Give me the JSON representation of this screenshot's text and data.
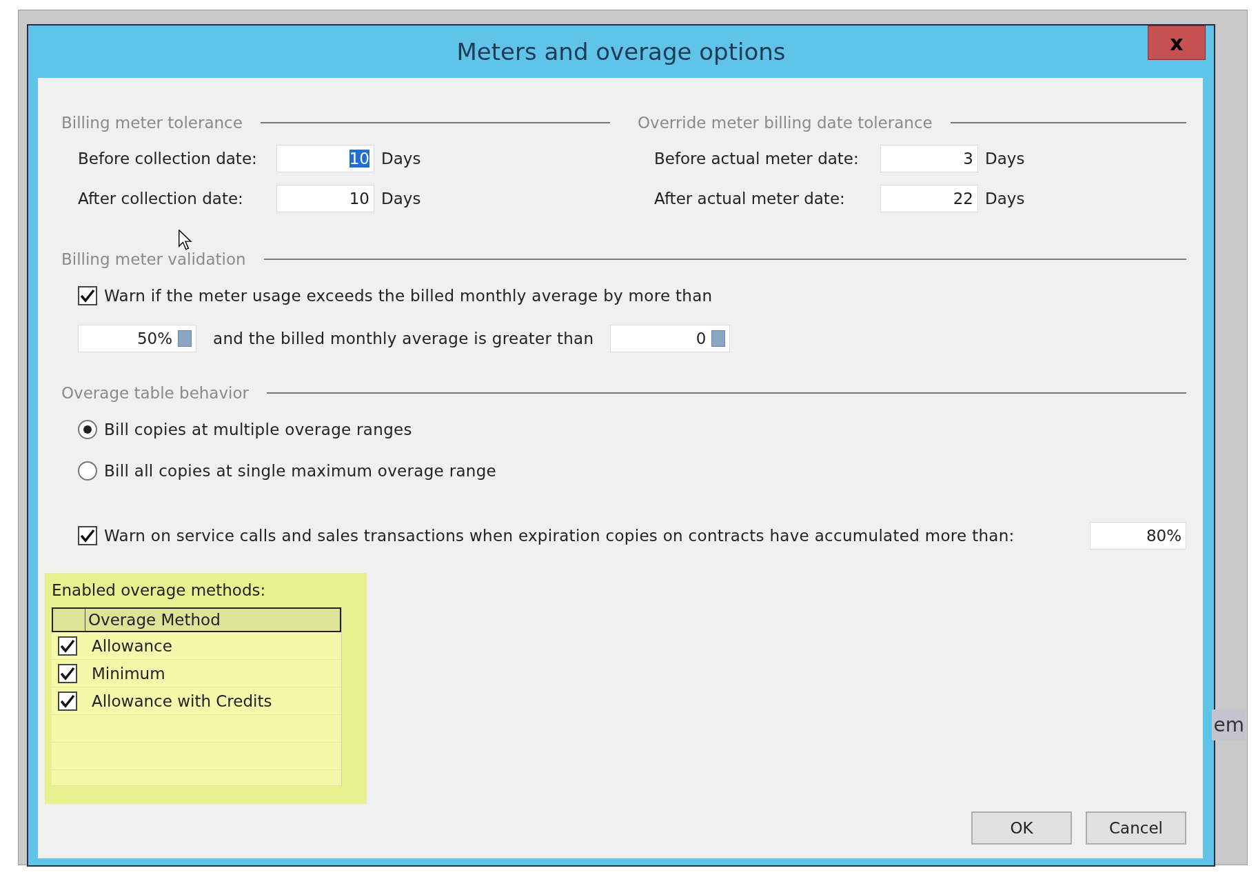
{
  "window": {
    "title": "Meters and overage options",
    "close": "x"
  },
  "tolerance": {
    "title": "Billing meter tolerance",
    "rows": [
      {
        "label": "Before collection date:",
        "value": "10",
        "text_selected": true,
        "unit": "Days"
      },
      {
        "label": "After collection date:",
        "value": "10",
        "text_selected": false,
        "unit": "Days"
      }
    ]
  },
  "override": {
    "title": "Override meter billing date tolerance",
    "rows": [
      {
        "label": "Before actual meter date:",
        "value": "3",
        "text_selected": false,
        "unit": "Days"
      },
      {
        "label": "After actual meter date:",
        "value": "22",
        "text_selected": false,
        "unit": "Days"
      }
    ]
  },
  "validation": {
    "title": "Billing meter validation",
    "warn": {
      "label": "Warn if the meter usage exceeds the billed monthly average by more than",
      "checked": true
    },
    "percent": {
      "value": "50%"
    },
    "middle_text": "and the billed monthly average is greater than",
    "minimum": {
      "value": "0"
    }
  },
  "overage_behavior": {
    "title": "Overage table behavior",
    "options": [
      {
        "label": "Bill copies at multiple overage ranges",
        "selected": true
      },
      {
        "label": "Bill all copies at single maximum overage range",
        "selected": false
      }
    ]
  },
  "expiration_warn": {
    "label": "Warn on service calls and sales transactions when expiration copies on contracts have accumulated more than:",
    "checked": true,
    "value": "80%"
  },
  "methods": {
    "label": "Enabled overage methods:",
    "column": "Overage Method",
    "rows": [
      {
        "label": "Allowance",
        "checked": true
      },
      {
        "label": "Minimum",
        "checked": true
      },
      {
        "label": "Allowance with Credits",
        "checked": true
      }
    ]
  },
  "buttons": [
    "OK",
    "Cancel"
  ],
  "background_text": "em"
}
